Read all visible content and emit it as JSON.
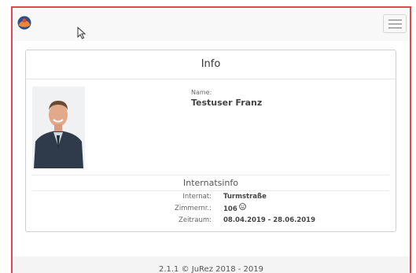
{
  "navbar": {
    "logo_icon": "app-logo-icon",
    "menu_icon": "hamburger-menu-icon"
  },
  "card": {
    "title": "Info",
    "name_label": "Name:",
    "name_value": "Testuser Franz",
    "section_title": "Internatsinfo",
    "rows": [
      {
        "label": "Internat:",
        "value": "Turmstraße"
      },
      {
        "label": "Zimmernr.:",
        "value": "106"
      },
      {
        "label": "Zeitraum:",
        "value": "08.04.2019 - 28.06.2019"
      }
    ]
  },
  "footer": {
    "text": "2.1.1 © JuRez 2018 - 2019"
  },
  "colors": {
    "frame_border": "#e0484f",
    "navbar_bg": "#f8f8f8",
    "footer_bg": "#f4f4f4"
  }
}
